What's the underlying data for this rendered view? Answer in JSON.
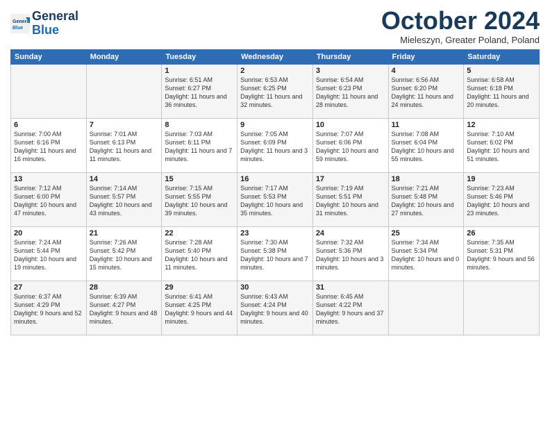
{
  "header": {
    "logo_line1": "General",
    "logo_line2": "Blue",
    "month": "October 2024",
    "location": "Mieleszyn, Greater Poland, Poland"
  },
  "days_of_week": [
    "Sunday",
    "Monday",
    "Tuesday",
    "Wednesday",
    "Thursday",
    "Friday",
    "Saturday"
  ],
  "weeks": [
    [
      {
        "day": "",
        "sunrise": "",
        "sunset": "",
        "daylight": ""
      },
      {
        "day": "",
        "sunrise": "",
        "sunset": "",
        "daylight": ""
      },
      {
        "day": "1",
        "sunrise": "Sunrise: 6:51 AM",
        "sunset": "Sunset: 6:27 PM",
        "daylight": "Daylight: 11 hours and 36 minutes."
      },
      {
        "day": "2",
        "sunrise": "Sunrise: 6:53 AM",
        "sunset": "Sunset: 6:25 PM",
        "daylight": "Daylight: 11 hours and 32 minutes."
      },
      {
        "day": "3",
        "sunrise": "Sunrise: 6:54 AM",
        "sunset": "Sunset: 6:23 PM",
        "daylight": "Daylight: 11 hours and 28 minutes."
      },
      {
        "day": "4",
        "sunrise": "Sunrise: 6:56 AM",
        "sunset": "Sunset: 6:20 PM",
        "daylight": "Daylight: 11 hours and 24 minutes."
      },
      {
        "day": "5",
        "sunrise": "Sunrise: 6:58 AM",
        "sunset": "Sunset: 6:18 PM",
        "daylight": "Daylight: 11 hours and 20 minutes."
      }
    ],
    [
      {
        "day": "6",
        "sunrise": "Sunrise: 7:00 AM",
        "sunset": "Sunset: 6:16 PM",
        "daylight": "Daylight: 11 hours and 16 minutes."
      },
      {
        "day": "7",
        "sunrise": "Sunrise: 7:01 AM",
        "sunset": "Sunset: 6:13 PM",
        "daylight": "Daylight: 11 hours and 11 minutes."
      },
      {
        "day": "8",
        "sunrise": "Sunrise: 7:03 AM",
        "sunset": "Sunset: 6:11 PM",
        "daylight": "Daylight: 11 hours and 7 minutes."
      },
      {
        "day": "9",
        "sunrise": "Sunrise: 7:05 AM",
        "sunset": "Sunset: 6:09 PM",
        "daylight": "Daylight: 11 hours and 3 minutes."
      },
      {
        "day": "10",
        "sunrise": "Sunrise: 7:07 AM",
        "sunset": "Sunset: 6:06 PM",
        "daylight": "Daylight: 10 hours and 59 minutes."
      },
      {
        "day": "11",
        "sunrise": "Sunrise: 7:08 AM",
        "sunset": "Sunset: 6:04 PM",
        "daylight": "Daylight: 10 hours and 55 minutes."
      },
      {
        "day": "12",
        "sunrise": "Sunrise: 7:10 AM",
        "sunset": "Sunset: 6:02 PM",
        "daylight": "Daylight: 10 hours and 51 minutes."
      }
    ],
    [
      {
        "day": "13",
        "sunrise": "Sunrise: 7:12 AM",
        "sunset": "Sunset: 6:00 PM",
        "daylight": "Daylight: 10 hours and 47 minutes."
      },
      {
        "day": "14",
        "sunrise": "Sunrise: 7:14 AM",
        "sunset": "Sunset: 5:57 PM",
        "daylight": "Daylight: 10 hours and 43 minutes."
      },
      {
        "day": "15",
        "sunrise": "Sunrise: 7:15 AM",
        "sunset": "Sunset: 5:55 PM",
        "daylight": "Daylight: 10 hours and 39 minutes."
      },
      {
        "day": "16",
        "sunrise": "Sunrise: 7:17 AM",
        "sunset": "Sunset: 5:53 PM",
        "daylight": "Daylight: 10 hours and 35 minutes."
      },
      {
        "day": "17",
        "sunrise": "Sunrise: 7:19 AM",
        "sunset": "Sunset: 5:51 PM",
        "daylight": "Daylight: 10 hours and 31 minutes."
      },
      {
        "day": "18",
        "sunrise": "Sunrise: 7:21 AM",
        "sunset": "Sunset: 5:48 PM",
        "daylight": "Daylight: 10 hours and 27 minutes."
      },
      {
        "day": "19",
        "sunrise": "Sunrise: 7:23 AM",
        "sunset": "Sunset: 5:46 PM",
        "daylight": "Daylight: 10 hours and 23 minutes."
      }
    ],
    [
      {
        "day": "20",
        "sunrise": "Sunrise: 7:24 AM",
        "sunset": "Sunset: 5:44 PM",
        "daylight": "Daylight: 10 hours and 19 minutes."
      },
      {
        "day": "21",
        "sunrise": "Sunrise: 7:26 AM",
        "sunset": "Sunset: 5:42 PM",
        "daylight": "Daylight: 10 hours and 15 minutes."
      },
      {
        "day": "22",
        "sunrise": "Sunrise: 7:28 AM",
        "sunset": "Sunset: 5:40 PM",
        "daylight": "Daylight: 10 hours and 11 minutes."
      },
      {
        "day": "23",
        "sunrise": "Sunrise: 7:30 AM",
        "sunset": "Sunset: 5:38 PM",
        "daylight": "Daylight: 10 hours and 7 minutes."
      },
      {
        "day": "24",
        "sunrise": "Sunrise: 7:32 AM",
        "sunset": "Sunset: 5:36 PM",
        "daylight": "Daylight: 10 hours and 3 minutes."
      },
      {
        "day": "25",
        "sunrise": "Sunrise: 7:34 AM",
        "sunset": "Sunset: 5:34 PM",
        "daylight": "Daylight: 10 hours and 0 minutes."
      },
      {
        "day": "26",
        "sunrise": "Sunrise: 7:35 AM",
        "sunset": "Sunset: 5:31 PM",
        "daylight": "Daylight: 9 hours and 56 minutes."
      }
    ],
    [
      {
        "day": "27",
        "sunrise": "Sunrise: 6:37 AM",
        "sunset": "Sunset: 4:29 PM",
        "daylight": "Daylight: 9 hours and 52 minutes."
      },
      {
        "day": "28",
        "sunrise": "Sunrise: 6:39 AM",
        "sunset": "Sunset: 4:27 PM",
        "daylight": "Daylight: 9 hours and 48 minutes."
      },
      {
        "day": "29",
        "sunrise": "Sunrise: 6:41 AM",
        "sunset": "Sunset: 4:25 PM",
        "daylight": "Daylight: 9 hours and 44 minutes."
      },
      {
        "day": "30",
        "sunrise": "Sunrise: 6:43 AM",
        "sunset": "Sunset: 4:24 PM",
        "daylight": "Daylight: 9 hours and 40 minutes."
      },
      {
        "day": "31",
        "sunrise": "Sunrise: 6:45 AM",
        "sunset": "Sunset: 4:22 PM",
        "daylight": "Daylight: 9 hours and 37 minutes."
      },
      {
        "day": "",
        "sunrise": "",
        "sunset": "",
        "daylight": ""
      },
      {
        "day": "",
        "sunrise": "",
        "sunset": "",
        "daylight": ""
      }
    ]
  ]
}
